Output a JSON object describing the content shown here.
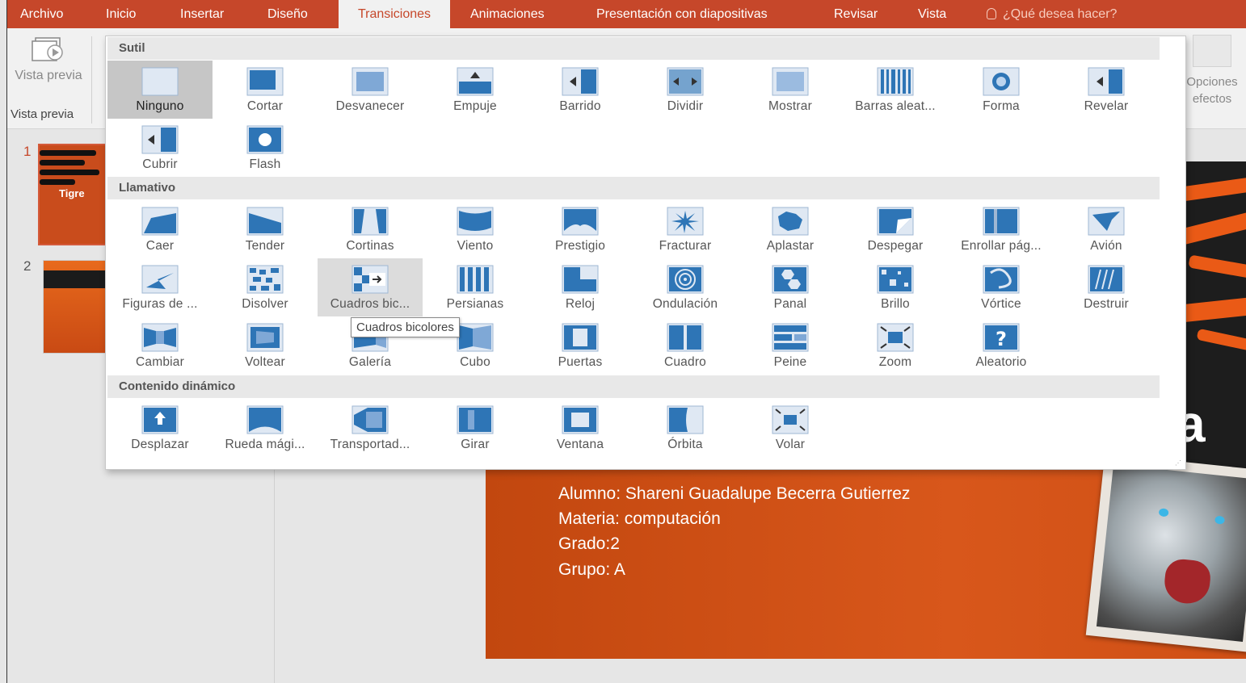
{
  "tabs": [
    {
      "label": "Archivo",
      "active": false
    },
    {
      "label": "Inicio",
      "active": false
    },
    {
      "label": "Insertar",
      "active": false
    },
    {
      "label": "Diseño",
      "active": false
    },
    {
      "label": "Transiciones",
      "active": true
    },
    {
      "label": "Animaciones",
      "active": false
    },
    {
      "label": "Presentación con diapositivas",
      "active": false
    },
    {
      "label": "Revisar",
      "active": false
    },
    {
      "label": "Vista",
      "active": false
    }
  ],
  "tell_me": "¿Qué desea hacer?",
  "ribbon": {
    "preview_label": "Vista previa",
    "preview_group": "Vista previa",
    "effect_options_label": "Opciones efectos"
  },
  "gallery": {
    "sections": [
      "Sutil",
      "Llamativo",
      "Contenido dinámico"
    ],
    "sutil": [
      "Ninguno",
      "Cortar",
      "Desvanecer",
      "Empuje",
      "Barrido",
      "Dividir",
      "Mostrar",
      "Barras aleat...",
      "Forma",
      "Revelar",
      "Cubrir",
      "Flash"
    ],
    "llamativo": [
      "Caer",
      "Tender",
      "Cortinas",
      "Viento",
      "Prestigio",
      "Fracturar",
      "Aplastar",
      "Despegar",
      "Enrollar pág...",
      "Avión",
      "Figuras de ...",
      "Disolver",
      "Cuadros bic...",
      "Persianas",
      "Reloj",
      "Ondulación",
      "Panal",
      "Brillo",
      "Vórtice",
      "Destruir",
      "Cambiar",
      "Voltear",
      "Galería",
      "Cubo",
      "Puertas",
      "Cuadro",
      "Peine",
      "Zoom",
      "Aleatorio"
    ],
    "dinamico": [
      "Desplazar",
      "Rueda mági...",
      "Transportad...",
      "Girar",
      "Ventana",
      "Órbita",
      "Volar"
    ],
    "selected": "Ninguno",
    "hovered": "Cuadros bic...",
    "tooltip": "Cuadros bicolores"
  },
  "slides": {
    "numbers": [
      "1",
      "2"
    ],
    "thumb1_title": "Tigre"
  },
  "slide": {
    "big_letter": "a",
    "lines": [
      "Alumno: Shareni Guadalupe Becerra Gutierrez",
      "Materia: computación",
      "Grado:2",
      "Grupo: A"
    ]
  },
  "colors": {
    "accent": "#c6472a",
    "icon_blue": "#2e75b6",
    "slide_orange": "#d8571b"
  }
}
